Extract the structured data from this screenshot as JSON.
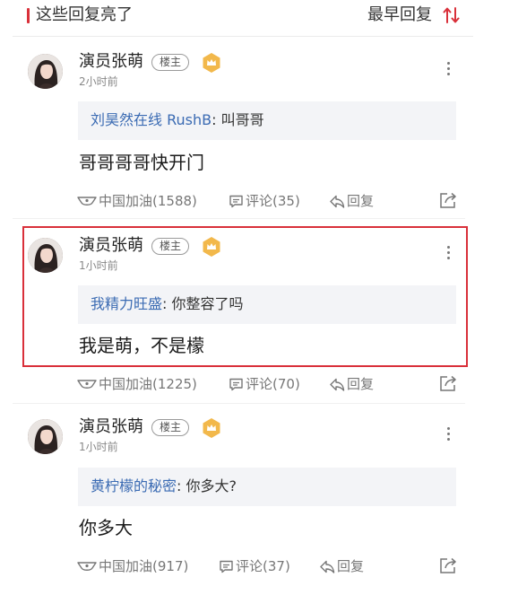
{
  "header": {
    "title": "这些回复亮了",
    "sort_label": "最早回复",
    "sort_icon": "sort-arrows-icon",
    "accent": "#d9303a"
  },
  "owner_badge_label": "楼主",
  "comments": [
    {
      "author": "演员张萌",
      "time": "2小时前",
      "quote_user": "刘昊然在线 RushB",
      "quote_text": ": 叫哥哥",
      "content": "哥哥哥哥快开门",
      "cheer_label": "中国加油",
      "cheer_count": "(1588)",
      "comment_label": "评论",
      "comment_count": "(35)",
      "reply_label": "回复"
    },
    {
      "author": "演员张萌",
      "time": "1小时前",
      "quote_user": "我精力旺盛",
      "quote_text": ": 你整容了吗",
      "content": "我是萌，不是檬",
      "cheer_label": "中国加油",
      "cheer_count": "(1225)",
      "comment_label": "评论",
      "comment_count": "(70)",
      "reply_label": "回复",
      "highlighted": true
    },
    {
      "author": "演员张萌",
      "time": "1小时前",
      "quote_user": "黄柠檬的秘密",
      "quote_text": ": 你多大?",
      "content": "你多大",
      "cheer_label": "中国加油",
      "cheer_count": "(917)",
      "comment_label": "评论",
      "comment_count": "(37)",
      "reply_label": "回复"
    }
  ],
  "colors": {
    "highlight_border": "#d9303a",
    "quote_user": "#3b6bb3",
    "crown": "#f2b84b"
  }
}
